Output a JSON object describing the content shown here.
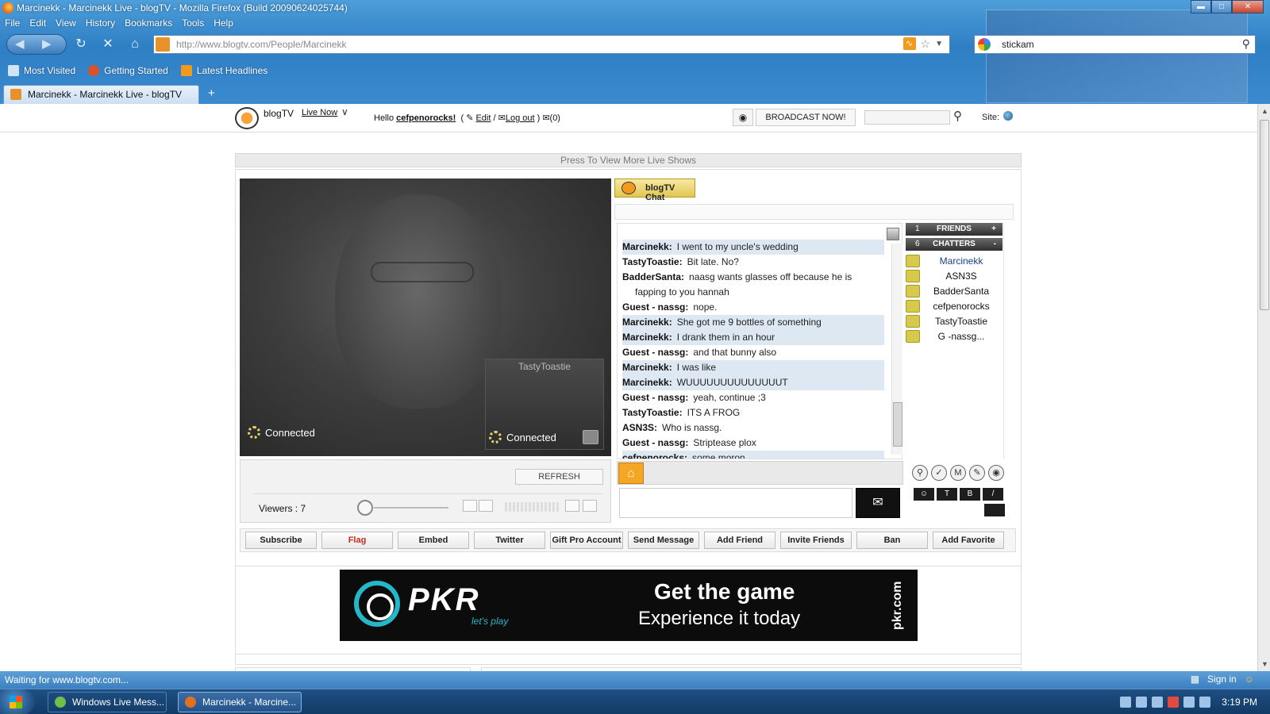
{
  "window": {
    "title": "Marcinekk - Marcinekk Live - blogTV - Mozilla Firefox (Build 20090624025744)"
  },
  "menu": [
    "File",
    "Edit",
    "View",
    "History",
    "Bookmarks",
    "Tools",
    "Help"
  ],
  "browser": {
    "url": "http://www.blogtv.com/People/Marcinekk",
    "search_value": "stickam"
  },
  "bookmarks": [
    {
      "label": "Most Visited",
      "icon": "bookmark-icon"
    },
    {
      "label": "Getting Started",
      "icon": "firefox-icon"
    },
    {
      "label": "Latest Headlines",
      "icon": "rss-icon"
    }
  ],
  "tab": {
    "title": "Marcinekk - Marcinekk Live - blogTV",
    "new_tab": "+"
  },
  "site_header": {
    "brand": "blogTV",
    "live_now": "Live Now",
    "hello_prefix": "Hello",
    "username": "cefpenorocks!",
    "edit": "Edit",
    "logout": "Log out",
    "messages": "(0)",
    "broadcast": "BROADCAST NOW!",
    "site_label": "Site:"
  },
  "press_banner": "Press To View More Live Shows",
  "video": {
    "status_main": "Connected",
    "pip_name": "TastyToastie",
    "status_pip": "Connected",
    "refresh": "REFRESH",
    "viewers": "Viewers : 7"
  },
  "chat": {
    "tab_label": "blogTV Chat",
    "messages": [
      {
        "who": "Marcinekk:",
        "text": "I went to my uncle's wedding",
        "hl": true
      },
      {
        "who": "TastyToastie:",
        "text": "Bit late. No?",
        "hl": false
      },
      {
        "who": "BadderSanta:",
        "text": "naasg wants glasses off because he is",
        "hl": false
      },
      {
        "who": "",
        "text": "fapping to you hannah",
        "hl": false
      },
      {
        "who": "Guest - nassg:",
        "text": "nope.",
        "hl": false
      },
      {
        "who": "Marcinekk:",
        "text": "She got me 9 bottles of something",
        "hl": true
      },
      {
        "who": "Marcinekk:",
        "text": "I drank them in an hour",
        "hl": true
      },
      {
        "who": "Guest - nassg:",
        "text": "and that bunny also",
        "hl": false
      },
      {
        "who": "Marcinekk:",
        "text": "I was like",
        "hl": true
      },
      {
        "who": "Marcinekk:",
        "text": "WUUUUUUUUUUUUUUT",
        "hl": true
      },
      {
        "who": "Guest - nassg:",
        "text": "yeah, continue ;3",
        "hl": false
      },
      {
        "who": "TastyToastie:",
        "text": "ITS A FROG",
        "hl": false
      },
      {
        "who": "ASN3S:",
        "text": "Who is nassg.",
        "hl": false
      },
      {
        "who": "Guest - nassg:",
        "text": "Striptease plox",
        "hl": false
      },
      {
        "who": "cefpenorocks:",
        "text": "some moron",
        "hl": true
      }
    ]
  },
  "users_panel": {
    "friends": {
      "count": "1",
      "label": "FRIENDS",
      "toggle": "+"
    },
    "chatters": {
      "count": "6",
      "label": "CHATTERS",
      "toggle": "-"
    },
    "list": [
      "Marcinekk",
      "ASN3S",
      "BadderSanta",
      "cefpenorocks",
      "TastyToastie",
      "G -nassg..."
    ]
  },
  "chat_format": [
    "T",
    "B",
    "/"
  ],
  "actions": [
    "Subscribe",
    "Flag",
    "Embed",
    "Twitter",
    "Gift Pro Account",
    "Send Message",
    "Add Friend",
    "Invite Friends",
    "Ban",
    "Add Favorite"
  ],
  "ad": {
    "brand": "PKR",
    "tagline": "let's play",
    "headline": "Get the game",
    "subline": "Experience it today",
    "domain": "pkr.com"
  },
  "statusbar": {
    "text": "Waiting for www.blogtv.com...",
    "sign_in": "Sign in"
  },
  "taskbar": {
    "tasks": [
      "Windows Live Mess...",
      "Marcinekk - Marcine..."
    ],
    "clock": "3:19 PM"
  }
}
